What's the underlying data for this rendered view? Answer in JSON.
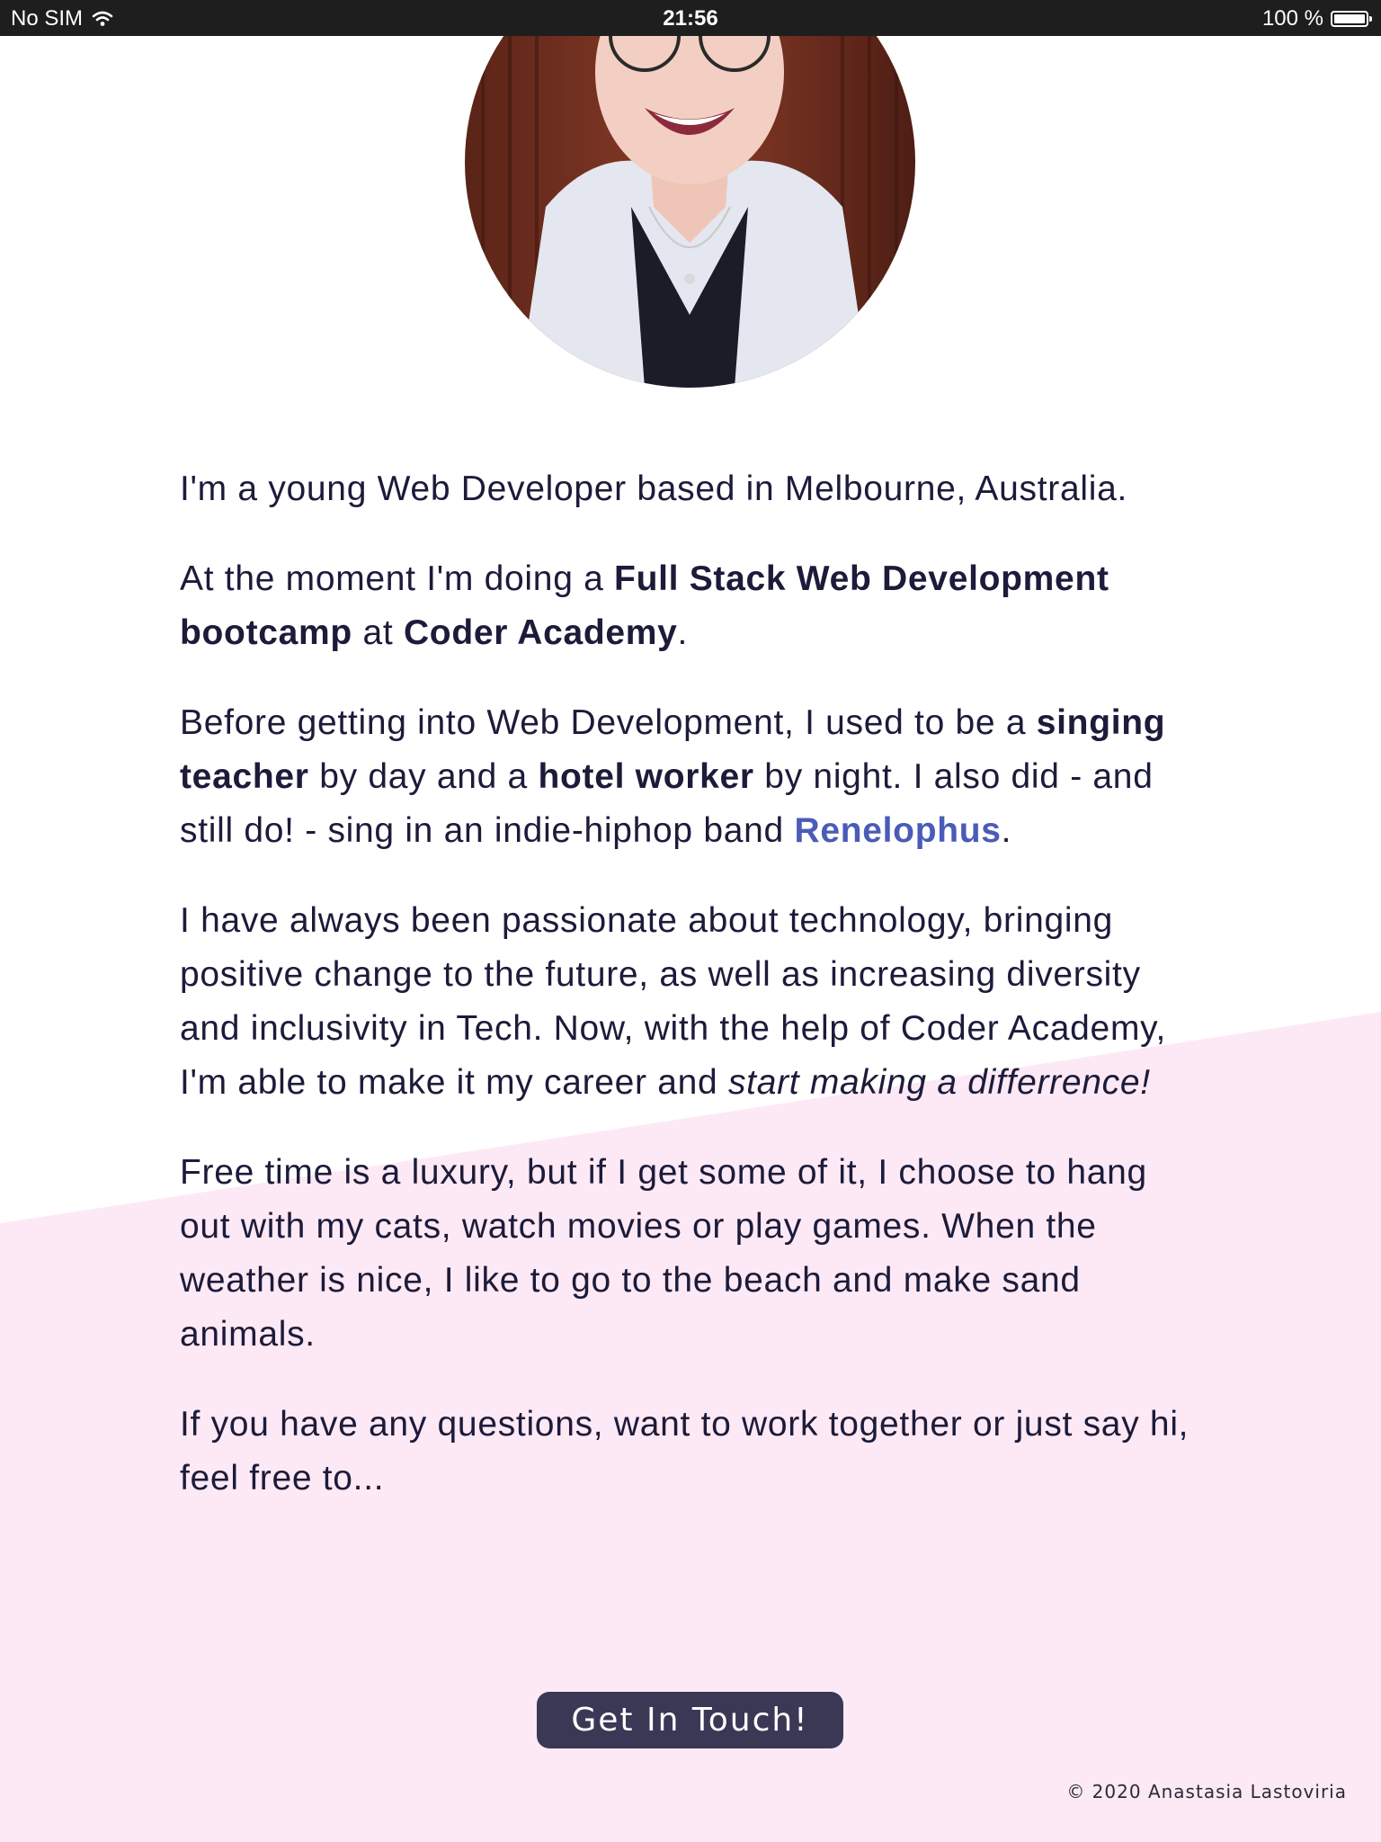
{
  "status_bar": {
    "carrier": "No SIM",
    "time": "21:56",
    "battery": "100 %"
  },
  "profile": {
    "photo_icon": "portrait-photo"
  },
  "paragraphs": {
    "p1": "I'm a young Web Developer based in Melbourne, Australia.",
    "p2": {
      "a": "At the moment I'm doing a ",
      "b": "Full Stack Web Development bootcamp",
      "c": " at ",
      "d": "Coder Academy",
      "e": "."
    },
    "p3": {
      "a": "Before getting into Web Development, I used to be a ",
      "b": "singing teacher",
      "c": " by day and a ",
      "d": "hotel worker",
      "e": " by night. I also did - and still do! - sing in an indie-hiphop band ",
      "link": "Renelophus",
      "f": "."
    },
    "p4": {
      "a": "I have always been passionate about technology, bringing positive change to the future, as well as increasing diversity and inclusivity in Tech. Now, with the help of Coder Academy, I'm able to make it my career and ",
      "em": "start making a differrence!"
    },
    "p5": "Free time is a luxury, but if I get some of it, I choose to hang out with my cats, watch movies or play games. When the weather is nice, I like to go to the beach and make sand animals.",
    "p6": "If you have any questions, want to work together or just say hi, feel free to..."
  },
  "cta_label": "Get In Touch!",
  "footer": "© 2020 Anastasia Lastoviria",
  "colors": {
    "background": "#ffffff",
    "pink_band": "#fde9f5",
    "text": "#1c1b3a",
    "link": "#4a5bb8",
    "button": "#3b3856"
  }
}
